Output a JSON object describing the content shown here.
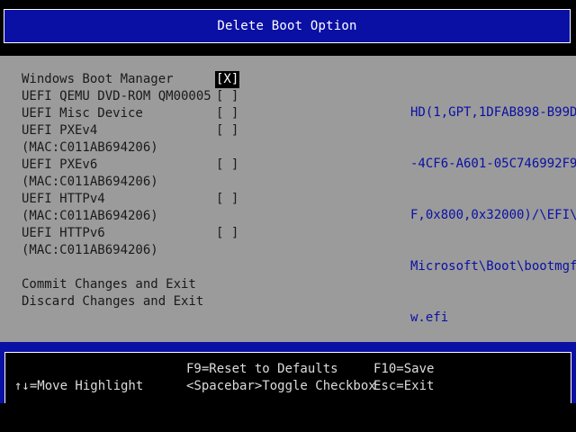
{
  "title": "Delete Boot Option",
  "boot_options": [
    {
      "label": "Windows Boot Manager",
      "checkbox": "[X]"
    },
    {
      "label": "UEFI QEMU DVD-ROM QM00005",
      "checkbox": "[ ]"
    },
    {
      "label": "UEFI Misc Device",
      "checkbox": "[ ]"
    },
    {
      "label": "UEFI PXEv4",
      "sub": "(MAC:C011AB694206)",
      "checkbox": "[ ]"
    },
    {
      "label": "UEFI PXEv6",
      "sub": "(MAC:C011AB694206)",
      "checkbox": "[ ]"
    },
    {
      "label": "UEFI HTTPv4",
      "sub": "(MAC:C011AB694206)",
      "checkbox": "[ ]"
    },
    {
      "label": "UEFI HTTPv6",
      "sub": "(MAC:C011AB694206)",
      "checkbox": "[ ]"
    }
  ],
  "actions": {
    "commit": "Commit Changes and Exit",
    "discard": "Discard Changes and Exit"
  },
  "help_lines": [
    "HD(1,GPT,1DFAB898-B99D",
    "-4CF6-A601-05C746992F9",
    "F,0x800,0x32000)/\\EFI\\",
    "Microsoft\\Boot\\bootmgf",
    "w.efi"
  ],
  "footer": {
    "move_highlight": "↑↓=Move Highlight",
    "f9": "F9=Reset to Defaults",
    "spacebar": "<Spacebar>Toggle Checkbox",
    "f10": "F10=Save",
    "esc": "Esc=Exit"
  },
  "colors": {
    "background": "#9b9b9b",
    "title_bg": "#0a10a4",
    "help_text": "#0a10a4",
    "footer_band": "#0a10a4",
    "footer_box": "#000000"
  }
}
